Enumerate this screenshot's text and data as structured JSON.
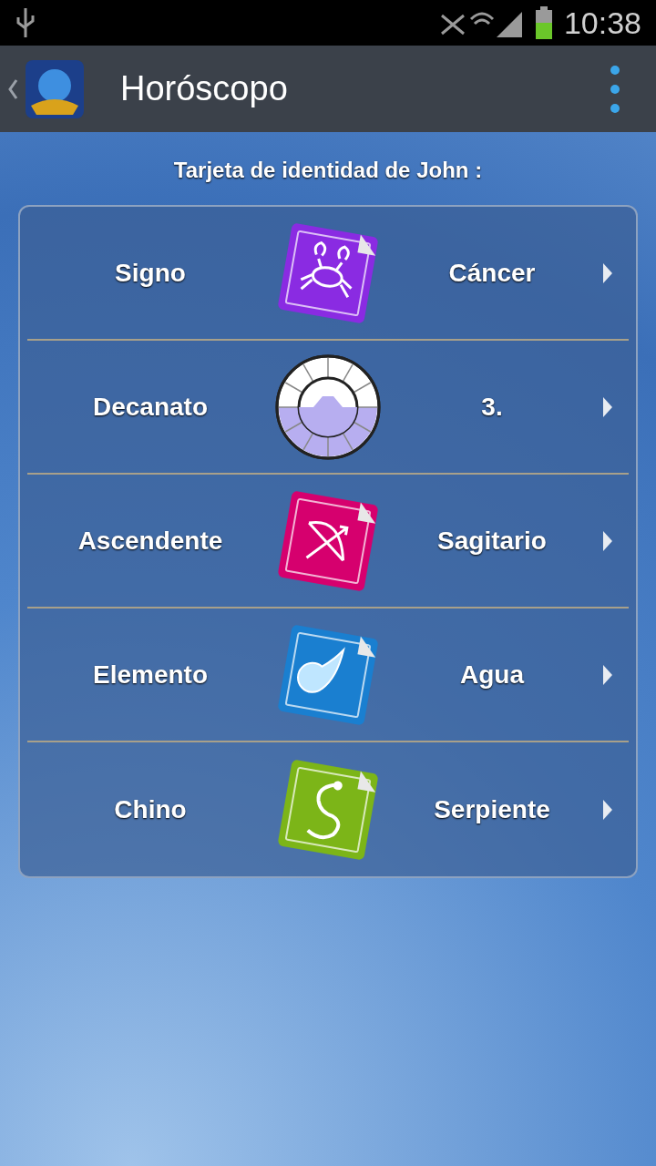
{
  "status_bar": {
    "time": "10:38"
  },
  "app_bar": {
    "title": "Horóscopo"
  },
  "heading": "Tarjeta de identidad de John :",
  "rows": [
    {
      "label": "Signo",
      "value": "Cáncer",
      "kind": "cancer"
    },
    {
      "label": "Decanato",
      "value": "3.",
      "kind": "decan"
    },
    {
      "label": "Ascendente",
      "value": "Sagitario",
      "kind": "sagittarius"
    },
    {
      "label": "Elemento",
      "value": "Agua",
      "kind": "water"
    },
    {
      "label": "Chino",
      "value": "Serpiente",
      "kind": "snake"
    }
  ]
}
